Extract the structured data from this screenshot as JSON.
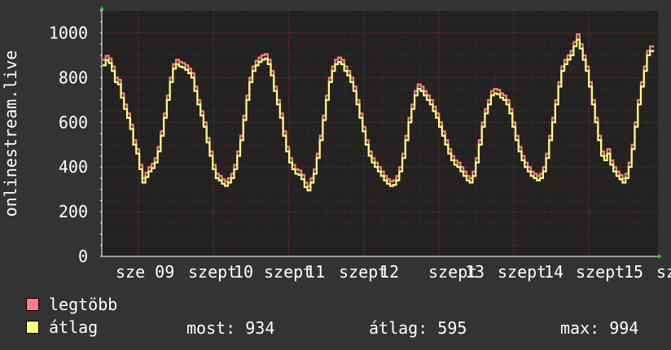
{
  "chart_data": {
    "type": "line",
    "ylabel": "onlinestream.live",
    "ylim": [
      0,
      1100
    ],
    "yticks": [
      0,
      200,
      400,
      600,
      800,
      1000
    ],
    "x_tick_labels": [
      "sze 09",
      "szept",
      "10",
      "szept",
      "11",
      "szept",
      "12",
      "szept",
      "13",
      "szept",
      "14",
      "szept",
      "15",
      "sze"
    ],
    "grid": true,
    "series": [
      {
        "name": "legtöbb",
        "color": "#ff7f7f",
        "values": [
          880,
          898,
          885,
          850,
          800,
          790,
          730,
          680,
          640,
          590,
          520,
          480,
          410,
          350,
          375,
          400,
          415,
          440,
          490,
          560,
          640,
          720,
          800,
          860,
          880,
          870,
          865,
          855,
          840,
          820,
          760,
          700,
          650,
          600,
          530,
          470,
          410,
          370,
          360,
          345,
          335,
          350,
          370,
          410,
          470,
          540,
          630,
          720,
          800,
          850,
          875,
          890,
          900,
          905,
          880,
          830,
          760,
          700,
          640,
          560,
          490,
          440,
          410,
          390,
          385,
          365,
          330,
          315,
          350,
          390,
          460,
          540,
          630,
          720,
          800,
          850,
          880,
          890,
          880,
          850,
          830,
          800,
          760,
          700,
          640,
          580,
          520,
          470,
          440,
          420,
          400,
          380,
          360,
          345,
          335,
          340,
          360,
          400,
          460,
          540,
          620,
          680,
          740,
          770,
          760,
          740,
          720,
          700,
          670,
          640,
          600,
          560,
          520,
          480,
          450,
          430,
          420,
          400,
          380,
          360,
          350,
          380,
          440,
          520,
          600,
          660,
          700,
          740,
          750,
          745,
          730,
          720,
          700,
          660,
          600,
          540,
          490,
          450,
          420,
          400,
          380,
          370,
          360,
          370,
          400,
          460,
          540,
          620,
          700,
          780,
          850,
          880,
          900,
          920,
          960,
          994,
          950,
          900,
          850,
          780,
          700,
          620,
          540,
          470,
          450,
          480,
          430,
          400,
          380,
          365,
          350,
          370,
          420,
          500,
          600,
          700,
          780,
          850,
          920,
          940,
          934
        ]
      },
      {
        "name": "átlag",
        "color": "#ffff7f",
        "values": [
          855,
          878,
          865,
          830,
          780,
          770,
          710,
          660,
          620,
          570,
          500,
          460,
          390,
          330,
          355,
          380,
          395,
          420,
          470,
          540,
          620,
          700,
          780,
          840,
          860,
          850,
          845,
          835,
          820,
          800,
          740,
          680,
          630,
          580,
          510,
          450,
          390,
          350,
          340,
          325,
          315,
          330,
          350,
          390,
          450,
          520,
          610,
          700,
          780,
          830,
          855,
          870,
          880,
          885,
          860,
          810,
          740,
          680,
          620,
          540,
          470,
          420,
          390,
          370,
          365,
          345,
          310,
          295,
          330,
          370,
          440,
          520,
          610,
          700,
          780,
          830,
          860,
          870,
          860,
          830,
          810,
          780,
          740,
          680,
          620,
          560,
          500,
          450,
          420,
          400,
          380,
          360,
          340,
          325,
          315,
          320,
          340,
          380,
          440,
          520,
          600,
          660,
          720,
          750,
          740,
          720,
          700,
          680,
          650,
          620,
          580,
          540,
          500,
          460,
          430,
          410,
          400,
          380,
          360,
          340,
          330,
          360,
          420,
          500,
          580,
          640,
          680,
          720,
          730,
          725,
          710,
          700,
          680,
          640,
          580,
          520,
          470,
          430,
          400,
          380,
          360,
          350,
          340,
          350,
          380,
          440,
          520,
          600,
          680,
          760,
          830,
          860,
          880,
          900,
          940,
          970,
          930,
          880,
          830,
          760,
          680,
          600,
          520,
          450,
          430,
          460,
          410,
          380,
          360,
          345,
          330,
          350,
          400,
          480,
          580,
          680,
          760,
          830,
          900,
          920,
          914
        ]
      }
    ]
  },
  "legend": [
    {
      "label": "legtöbb",
      "color": "#ff7f7f"
    },
    {
      "label": "átlag",
      "color": "#ffff7f"
    }
  ],
  "stats": {
    "most": "most: 934",
    "atlag": "átlag: 595",
    "max": "max: 994"
  },
  "colors": {
    "background": "#333333",
    "plot_area": "#222222",
    "grid": "#aa3333",
    "arrow": "#22cc22"
  }
}
